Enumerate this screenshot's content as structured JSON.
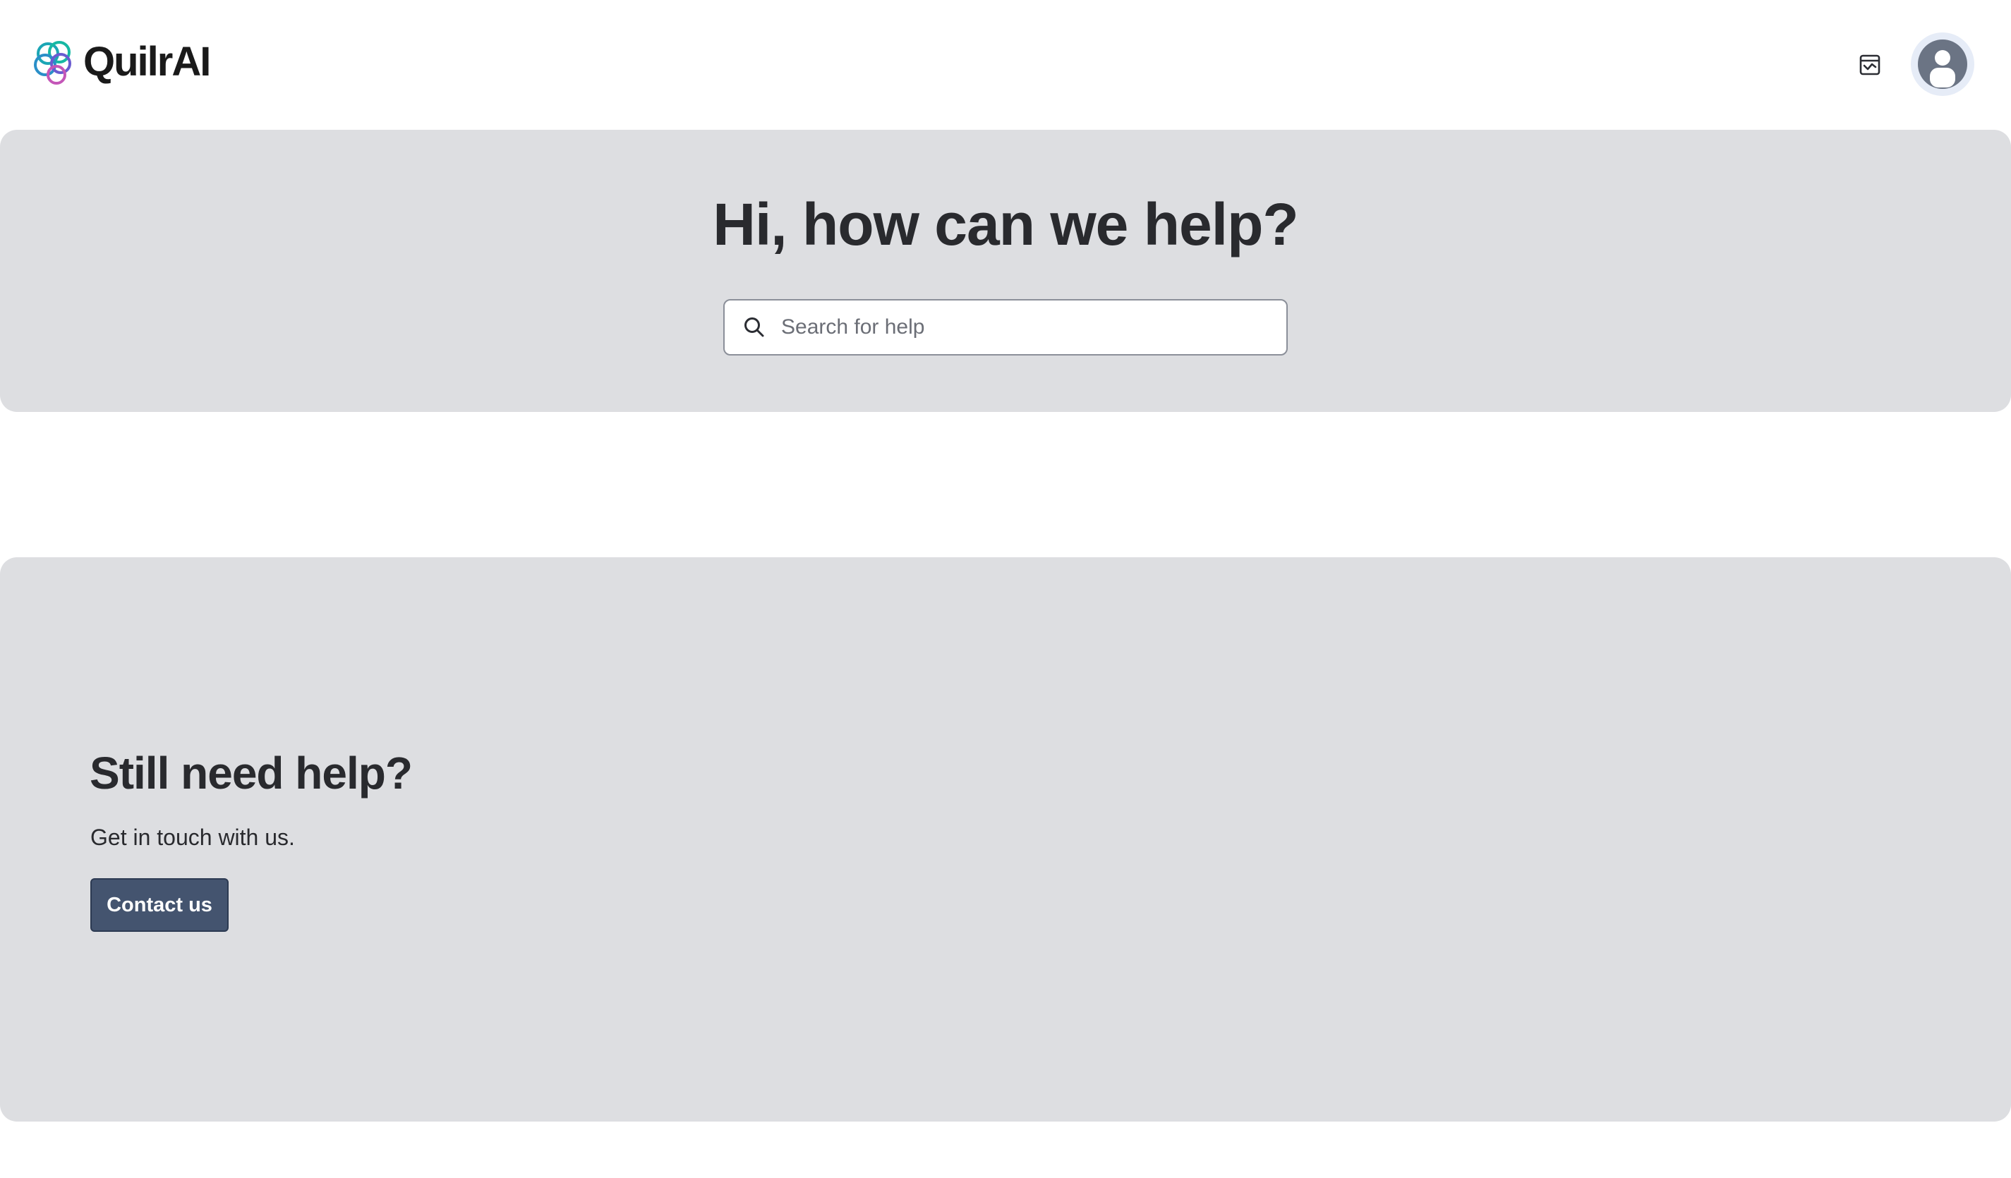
{
  "header": {
    "brand": "QuilrAI",
    "icons": {
      "logo": "quilrai-logo-icon",
      "inbox": "inbox-icon",
      "avatar": "user-avatar-icon"
    }
  },
  "hero": {
    "title": "Hi, how can we help?",
    "search": {
      "placeholder": "Search for help",
      "value": "",
      "icon": "search-icon"
    }
  },
  "support": {
    "title": "Still need help?",
    "subtitle": "Get in touch with us.",
    "contact_label": "Contact us"
  },
  "colors": {
    "panel_bg": "#dddee1",
    "button_bg": "#44546f",
    "text": "#292a2e",
    "avatar_ring": "#e6ecf7"
  }
}
